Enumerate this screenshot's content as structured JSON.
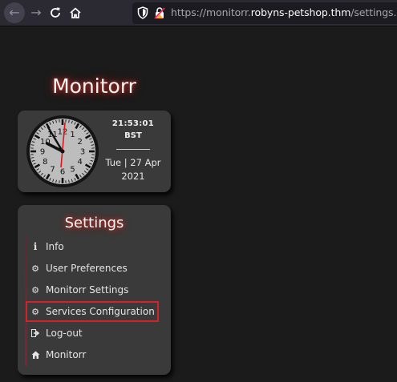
{
  "browser": {
    "url_prefix": "https://monitorr.",
    "url_domain": "robyns-petshop.thm",
    "url_suffix": "/settings.php"
  },
  "page": {
    "title": "Monitorr"
  },
  "clock": {
    "numbers": [
      "12",
      "1",
      "2",
      "3",
      "4",
      "5",
      "6",
      "7",
      "8",
      "9",
      "10",
      "11"
    ],
    "time": "21:53:01",
    "timezone": "BST",
    "date_line1": "Tue | 27 Apr",
    "date_line2": "2021"
  },
  "settings": {
    "title": "Settings",
    "items": [
      {
        "label": "Info",
        "icon": "info-icon"
      },
      {
        "label": "User Preferences",
        "icon": "gear-icon"
      },
      {
        "label": "Monitorr Settings",
        "icon": "gear-icon"
      },
      {
        "label": "Services Configuration",
        "icon": "gear-icon"
      },
      {
        "label": "Log-out",
        "icon": "sign-out-icon"
      },
      {
        "label": "Monitorr",
        "icon": "home-icon"
      }
    ]
  },
  "colors": {
    "accent": "#d2232a",
    "glow": "#d4372f",
    "card_bg": "#3a3a3a",
    "page_bg": "#1b1b1b"
  }
}
